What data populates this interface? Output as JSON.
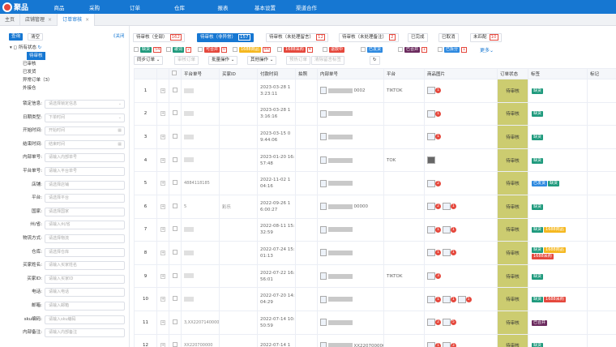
{
  "nav": {
    "logo": "聚品",
    "items": [
      "商品",
      "采购",
      "订单",
      "仓库",
      "报表",
      "基本设置",
      "渠道合作"
    ]
  },
  "tabs": [
    {
      "label": "主页"
    },
    {
      "label": "店铺管理"
    },
    {
      "label": "订单审核"
    }
  ],
  "sidebar": {
    "query_label": "查询",
    "clear_label": "清空",
    "close_label": "《关闭",
    "tree": {
      "root": "所有状态",
      "items": [
        "待审核",
        "已审核",
        "已发货",
        "异常订单（3）",
        "外接仓"
      ]
    },
    "fields": [
      {
        "label": "锁定信息:",
        "placeholder": "请选择锁定信息",
        "suffix": "⌄"
      },
      {
        "label": "日期类型:",
        "placeholder": "下单时间",
        "suffix": "⌄"
      },
      {
        "label": "开始时间:",
        "placeholder": "开始时间",
        "suffix": "▦"
      },
      {
        "label": "结束时间:",
        "placeholder": "结束时间",
        "suffix": "▦"
      },
      {
        "label": "内部单号:",
        "placeholder": "请输入内部单号",
        "suffix": ""
      },
      {
        "label": "平台单号:",
        "placeholder": "请输入平台单号",
        "suffix": ""
      },
      {
        "label": "店铺:",
        "placeholder": "请选择店铺",
        "suffix": ""
      },
      {
        "label": "平台:",
        "placeholder": "请选择平台",
        "suffix": ""
      },
      {
        "label": "国家:",
        "placeholder": "请选择国家",
        "suffix": ""
      },
      {
        "label": "州/省:",
        "placeholder": "请输入州/省",
        "suffix": ""
      },
      {
        "label": "物流方式:",
        "placeholder": "请选择物流",
        "suffix": ""
      },
      {
        "label": "仓库:",
        "placeholder": "请选择仓库",
        "suffix": ""
      },
      {
        "label": "买家姓名:",
        "placeholder": "请输入买家姓名",
        "suffix": ""
      },
      {
        "label": "买家ID:",
        "placeholder": "请输入买家ID",
        "suffix": ""
      },
      {
        "label": "电话:",
        "placeholder": "请输入电话",
        "suffix": ""
      },
      {
        "label": "邮箱:",
        "placeholder": "请输入邮箱",
        "suffix": ""
      },
      {
        "label": "sku编码:",
        "placeholder": "请输入sku编码",
        "suffix": ""
      },
      {
        "label": "内部备注:",
        "placeholder": "请输入内部备注",
        "suffix": ""
      }
    ]
  },
  "status_buttons": [
    {
      "label": "待审核（全部）",
      "count": "162"
    },
    {
      "label": "待审核（非异常）",
      "count": "157"
    },
    {
      "label": "待审核（未处理留言）",
      "count": "12"
    },
    {
      "label": "待审核（未处理备注）",
      "count": "2"
    },
    {
      "label": "已完成",
      "count": ""
    },
    {
      "label": "已取消",
      "count": ""
    },
    {
      "label": "未匹配",
      "count": "10"
    }
  ],
  "tag_filters": [
    {
      "label": "缺货",
      "count": "54",
      "color": "#1f9a7d"
    },
    {
      "label": "歌词",
      "count": "2",
      "color": "#1f9a7d"
    },
    {
      "label": "可合并",
      "count": "0",
      "color": "#e5483d"
    },
    {
      "label": "1688商品",
      "count": "44",
      "color": "#f5b820"
    },
    {
      "label": "1688采购",
      "count": "4",
      "color": "#e5483d"
    },
    {
      "label": "退款中",
      "count": "",
      "color": "#e5483d"
    },
    {
      "label": "已发货",
      "count": "",
      "color": "#2f8ae0"
    },
    {
      "label": "已合并",
      "count": "1",
      "color": "#6b2a5e"
    },
    {
      "label": "已拆分",
      "count": "1",
      "color": "#2f8ae0"
    },
    {
      "label": "更多⌄",
      "count": "",
      "color": ""
    }
  ],
  "toolbar": [
    "同步订单 ⌄",
    "审核订单",
    "批量操作 ⌄",
    "其他操作 ⌄",
    "预热订单",
    "清除留言标签",
    "↻"
  ],
  "table": {
    "headers": [
      "",
      "",
      "",
      "平台单号",
      "买家ID",
      "付款时间",
      "拍照",
      "内部单号",
      "平台",
      "商品图片",
      "订单状态",
      "标签",
      "标记"
    ],
    "rows": [
      {
        "no": "1",
        "platform_no": "",
        "buyer": "",
        "pay_time": "2023-03-28 1\n3:23:11",
        "inner": "0002",
        "platform": "TIKTOK",
        "img": "1",
        "status": "待审核",
        "tags": [
          {
            "t": "缺货",
            "c": "#1f9a7d"
          }
        ]
      },
      {
        "no": "2",
        "platform_no": "",
        "buyer": "",
        "pay_time": "2023-03-28 1\n3:16:16",
        "inner": "",
        "platform": "",
        "img": "1",
        "status": "待审核",
        "tags": [
          {
            "t": "缺货",
            "c": "#1f9a7d"
          }
        ]
      },
      {
        "no": "3",
        "platform_no": "",
        "buyer": "",
        "pay_time": "2023-03-15 0\n9:44:06",
        "inner": "",
        "platform": "",
        "img": "1",
        "status": "待审核",
        "tags": [
          {
            "t": "缺货",
            "c": "#1f9a7d"
          }
        ]
      },
      {
        "no": "4",
        "platform_no": "",
        "buyer": "",
        "pay_time": "2023-01-20 16:\n57:48",
        "inner": "",
        "platform": "TOK",
        "img": "",
        "status": "待审核",
        "tags": [
          {
            "t": "缺货",
            "c": "#1f9a7d"
          }
        ]
      },
      {
        "no": "5",
        "platform_no": "4884118185",
        "buyer": "",
        "pay_time": "2022-11-02 1\n04:16",
        "inner": "",
        "platform": "",
        "img": "2",
        "status": "待审核",
        "tags": [
          {
            "t": "已发货",
            "c": "#2f8ae0"
          },
          {
            "t": "缺货",
            "c": "#1f9a7d"
          }
        ]
      },
      {
        "no": "6",
        "platform_no": "5",
        "buyer": "彩乐",
        "pay_time": "2022-09-26 1\n6:00:27",
        "inner": "00000",
        "platform": "",
        "img": "2 1",
        "status": "待审核",
        "tags": [
          {
            "t": "缺货",
            "c": "#1f9a7d"
          }
        ]
      },
      {
        "no": "7",
        "platform_no": "",
        "buyer": "",
        "pay_time": "2022-08-11 15:\n32:59",
        "inner": "",
        "platform": "",
        "img": "1 1",
        "status": "待审核",
        "tags": [
          {
            "t": "缺货",
            "c": "#1f9a7d"
          },
          {
            "t": "1688商品",
            "c": "#f5b820"
          }
        ]
      },
      {
        "no": "8",
        "platform_no": "",
        "buyer": "",
        "pay_time": "2022-07-24 15:\n01:13",
        "inner": "",
        "platform": "",
        "img": "1 1",
        "status": "待审核",
        "tags": [
          {
            "t": "缺货",
            "c": "#1f9a7d"
          },
          {
            "t": "1688商品",
            "c": "#f5b820"
          },
          {
            "t": "1688采购",
            "c": "#e5483d"
          }
        ]
      },
      {
        "no": "9",
        "platform_no": "",
        "buyer": "",
        "pay_time": "2022-07-22 16:\n56:01",
        "inner": "",
        "platform": "TIKTOK",
        "img": "3",
        "status": "待审核",
        "tags": [
          {
            "t": "缺货",
            "c": "#1f9a7d"
          }
        ]
      },
      {
        "no": "10",
        "platform_no": "",
        "buyer": "",
        "pay_time": "2022-07-20 14:\n04:29",
        "inner": "",
        "platform": "",
        "img": "1 1 1",
        "status": "待审核",
        "tags": [
          {
            "t": "缺货",
            "c": "#1f9a7d"
          },
          {
            "t": "1688采购",
            "c": "#e5483d"
          }
        ]
      },
      {
        "no": "11",
        "platform_no": "3,XX2207140000",
        "buyer": "",
        "pay_time": "2022-07-14 10:\n50:59",
        "inner": "",
        "platform": "",
        "img": "2 5",
        "status": "待审核",
        "tags": [
          {
            "t": "已合并",
            "c": "#6b2a5e"
          }
        ]
      },
      {
        "no": "12",
        "platform_no": "XX220700000",
        "buyer": "",
        "pay_time": "2022-07-14 1",
        "inner": "XX2207000000",
        "platform": "",
        "img": "1 3",
        "status": "待审核",
        "tags": [
          {
            "t": "缺货",
            "c": "#1f9a7d"
          }
        ]
      }
    ]
  }
}
